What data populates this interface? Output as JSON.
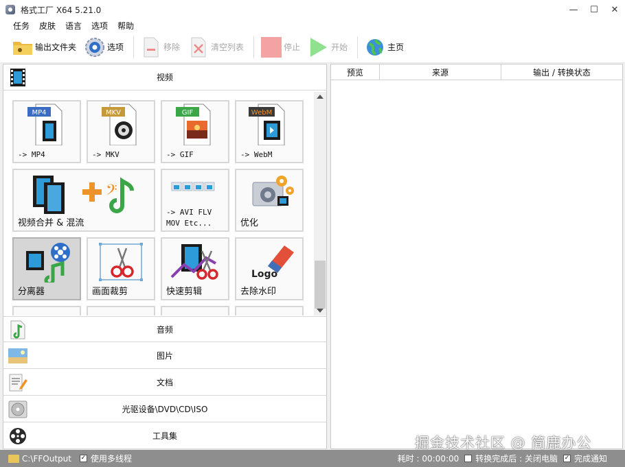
{
  "window": {
    "title": "格式工厂 X64 5.21.0",
    "controls": [
      "—",
      "☐",
      "✕"
    ]
  },
  "menu": [
    "任务",
    "皮肤",
    "语言",
    "选项",
    "帮助"
  ],
  "toolbar": {
    "output_folder": "输出文件夹",
    "options": "选项",
    "remove": "移除",
    "clear_list": "清空列表",
    "stop": "停止",
    "start": "开始",
    "home": "主页"
  },
  "categories": {
    "video": "视频",
    "audio": "音频",
    "image": "图片",
    "document": "文档",
    "disc": "光驱设备\\DVD\\CD\\ISO",
    "tools": "工具集"
  },
  "video_tiles": [
    {
      "label": "-> MP4",
      "badge": "MP4",
      "badge_color": "#3b6cc2"
    },
    {
      "label": "-> MKV",
      "badge": "MKV",
      "badge_color": "#c69a3a"
    },
    {
      "label": "-> GIF",
      "badge": "GIF",
      "badge_color": "#3aa648"
    },
    {
      "label": "-> WebM",
      "badge": "WebM",
      "badge_color": "#e0862a"
    },
    {
      "label": "视频合并 & 混流"
    },
    {
      "label": "-> AVI FLV\nMOV Etc..."
    },
    {
      "label": "优化"
    },
    {
      "label": "分离器"
    },
    {
      "label": "画面裁剪"
    },
    {
      "label": "快速剪辑"
    },
    {
      "label": "去除水印",
      "logo_text": "Logo"
    }
  ],
  "task_table": {
    "columns": [
      "预览",
      "来源",
      "输出 / 转换状态"
    ]
  },
  "watermark": "掘金技术社区 @ 简鹿办公",
  "statusbar": {
    "output_path": "C:\\FFOutput",
    "multithread": "使用多线程",
    "elapsed": "耗时 : 00:00:00",
    "after_convert": "转换完成后 : 关闭电脑",
    "notify": "完成通知"
  }
}
